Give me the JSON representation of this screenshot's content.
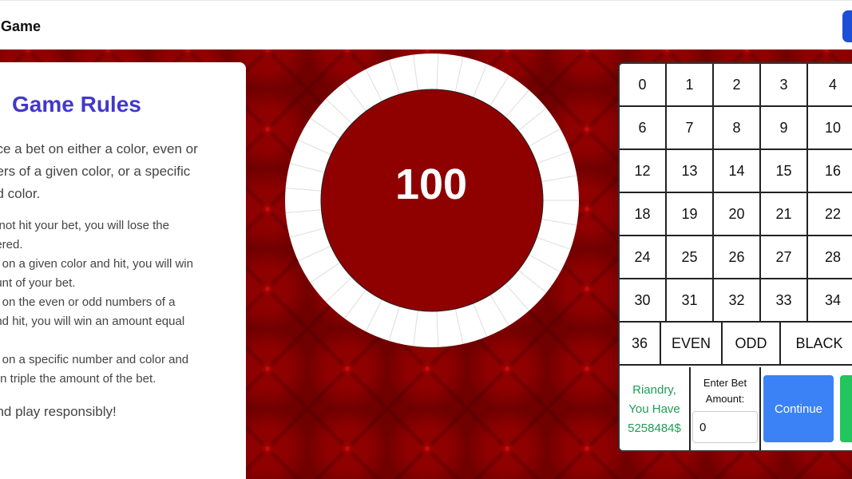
{
  "header": {
    "title": "Game",
    "accent_button_color": "#1d4ed8"
  },
  "rules": {
    "title": "Game Rules",
    "intro": "ace a bet on either a color, even or\npers of a given color, or a specific\nnd color.",
    "items": [
      "o not hit your bet, you will lose the\ngered.",
      "et on a given color and hit, you will win\nount of your bet.",
      "et on the even or odd numbers of a\nand hit, you will win an amount equal",
      "et on a specific number and color and\nwin triple the amount of the bet."
    ],
    "closing": "and play responsibly!"
  },
  "wheel": {
    "value": "100",
    "ring_color": "#ffffff",
    "center_color": "#8f0000"
  },
  "board": {
    "rows": [
      [
        "0",
        "1",
        "2",
        "3",
        "4"
      ],
      [
        "6",
        "7",
        "8",
        "9",
        "10"
      ],
      [
        "12",
        "13",
        "14",
        "15",
        "16"
      ],
      [
        "18",
        "19",
        "20",
        "21",
        "22"
      ],
      [
        "24",
        "25",
        "26",
        "27",
        "28"
      ],
      [
        "30",
        "31",
        "32",
        "33",
        "34"
      ]
    ],
    "last_row": [
      "36",
      "EVEN",
      "ODD",
      "BLACK"
    ]
  },
  "player": {
    "status": "Riandry,\nYou Have\n5258484$",
    "bet_label": "Enter Bet\nAmount:",
    "bet_value": "0",
    "continue_label": "Continue",
    "second_button_label": "",
    "continue_color": "#3b82f6",
    "second_button_color": "#22c55e",
    "status_color": "#1f9d55"
  }
}
